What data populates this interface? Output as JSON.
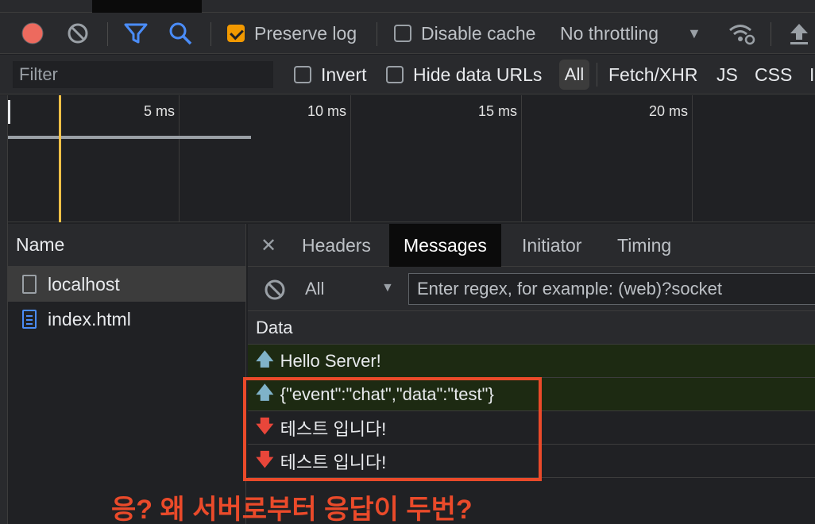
{
  "toolbar": {
    "preserve_log_label": "Preserve log",
    "preserve_log_checked": true,
    "disable_cache_label": "Disable cache",
    "throttling_value": "No throttling"
  },
  "filterbar": {
    "filter_placeholder": "Filter",
    "invert_label": "Invert",
    "hide_data_urls_label": "Hide data URLs",
    "types": [
      "All",
      "Fetch/XHR",
      "JS",
      "CSS"
    ]
  },
  "timeline": {
    "ticks": [
      "5 ms",
      "10 ms",
      "15 ms",
      "20 ms"
    ]
  },
  "name_pane": {
    "header": "Name",
    "items": [
      {
        "name": "localhost",
        "selected": true
      },
      {
        "name": "index.html",
        "selected": false
      }
    ]
  },
  "detail": {
    "tabs": [
      "Headers",
      "Messages",
      "Initiator",
      "Timing"
    ],
    "active_tab": "Messages",
    "message_filter_type": "All",
    "message_filter_placeholder": "Enter regex, for example: (web)?socket",
    "data_header": "Data",
    "messages": [
      {
        "direction": "sent",
        "text": "Hello Server!"
      },
      {
        "direction": "sent",
        "text": "{\"event\":\"chat\",\"data\":\"test\"}"
      },
      {
        "direction": "received",
        "text": "테스트 입니다!"
      },
      {
        "direction": "received",
        "text": "테스트 입니다!"
      }
    ]
  },
  "annotation": {
    "text": "응? 왜 서버로부터 응답이 두번?",
    "color": "#ea4a2a"
  }
}
